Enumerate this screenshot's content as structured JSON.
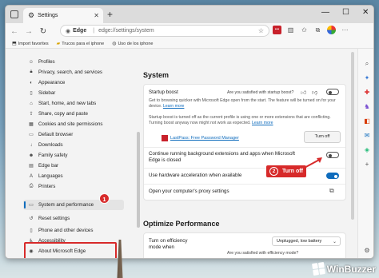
{
  "browser": {
    "tab_title": "Settings",
    "new_tab": "+",
    "window_controls": {
      "minimize": "—",
      "maximize": "☐",
      "close": "✕"
    },
    "address": {
      "brand": "Edge",
      "url": "edge://settings/system"
    },
    "favorites": [
      {
        "label": "Import favorites",
        "icon": "import-icon"
      },
      {
        "label": "Trucos para el iphone",
        "icon": "folder-icon"
      },
      {
        "label": "Uso de los iphone",
        "icon": "globe-icon"
      }
    ]
  },
  "sidebar": {
    "items": [
      {
        "label": "Profiles",
        "icon": "person-icon"
      },
      {
        "label": "Privacy, search, and services",
        "icon": "lock-icon"
      },
      {
        "label": "Appearance",
        "icon": "palette-icon"
      },
      {
        "label": "Sidebar",
        "icon": "sidebar-icon"
      },
      {
        "label": "Start, home, and new tabs",
        "icon": "home-icon"
      },
      {
        "label": "Share, copy and paste",
        "icon": "share-icon"
      },
      {
        "label": "Cookies and site permissions",
        "icon": "cookie-icon"
      },
      {
        "label": "Default browser",
        "icon": "browser-icon"
      },
      {
        "label": "Downloads",
        "icon": "download-icon"
      },
      {
        "label": "Family safety",
        "icon": "family-icon"
      },
      {
        "label": "Edge bar",
        "icon": "bar-icon"
      },
      {
        "label": "Languages",
        "icon": "language-icon"
      },
      {
        "label": "Printers",
        "icon": "printer-icon"
      },
      {
        "label": "System and performance",
        "icon": "system-icon"
      },
      {
        "label": "Reset settings",
        "icon": "reset-icon"
      },
      {
        "label": "Phone and other devices",
        "icon": "phone-icon"
      },
      {
        "label": "Accessibility",
        "icon": "accessibility-icon"
      },
      {
        "label": "About Microsoft Edge",
        "icon": "edge-icon"
      }
    ],
    "active_index": 13,
    "callout_number": "1"
  },
  "main": {
    "section_title": "System",
    "startup_boost": {
      "title": "Startup boost",
      "question": "Are you satisfied with startup boost?",
      "enabled": false,
      "description": "Get to browsing quicker with Microsoft Edge open from the start. The feature will be turned on for your device.",
      "learn_more": "Learn more",
      "warning": "Startup boost is turned off as the current profile is using one or more extensions that are conflicting. Turning boost anyway now might not work as expected.",
      "learn_more_2": "Learn more",
      "extension_name": "LastPass: Free Password Manager",
      "turn_off_button": "Turn off"
    },
    "background_apps": {
      "title": "Continue running background extensions and apps when Microsoft Edge is closed",
      "enabled": false
    },
    "hardware_acceleration": {
      "title": "Use hardware acceleration when available",
      "enabled": true
    },
    "proxy": {
      "title": "Open your computer's proxy settings"
    },
    "callout": {
      "number": "2",
      "label": "Turn off"
    },
    "optimize_title": "Optimize Performance",
    "efficiency": {
      "title": "Turn on efficiency mode when",
      "dropdown_value": "Unplugged, low battery",
      "question": "Are you satisfied with efficiency mode?"
    }
  },
  "watermark": "WinBuzzer",
  "colors": {
    "accent": "#0f6cbd",
    "annotation": "#d72a2a"
  }
}
